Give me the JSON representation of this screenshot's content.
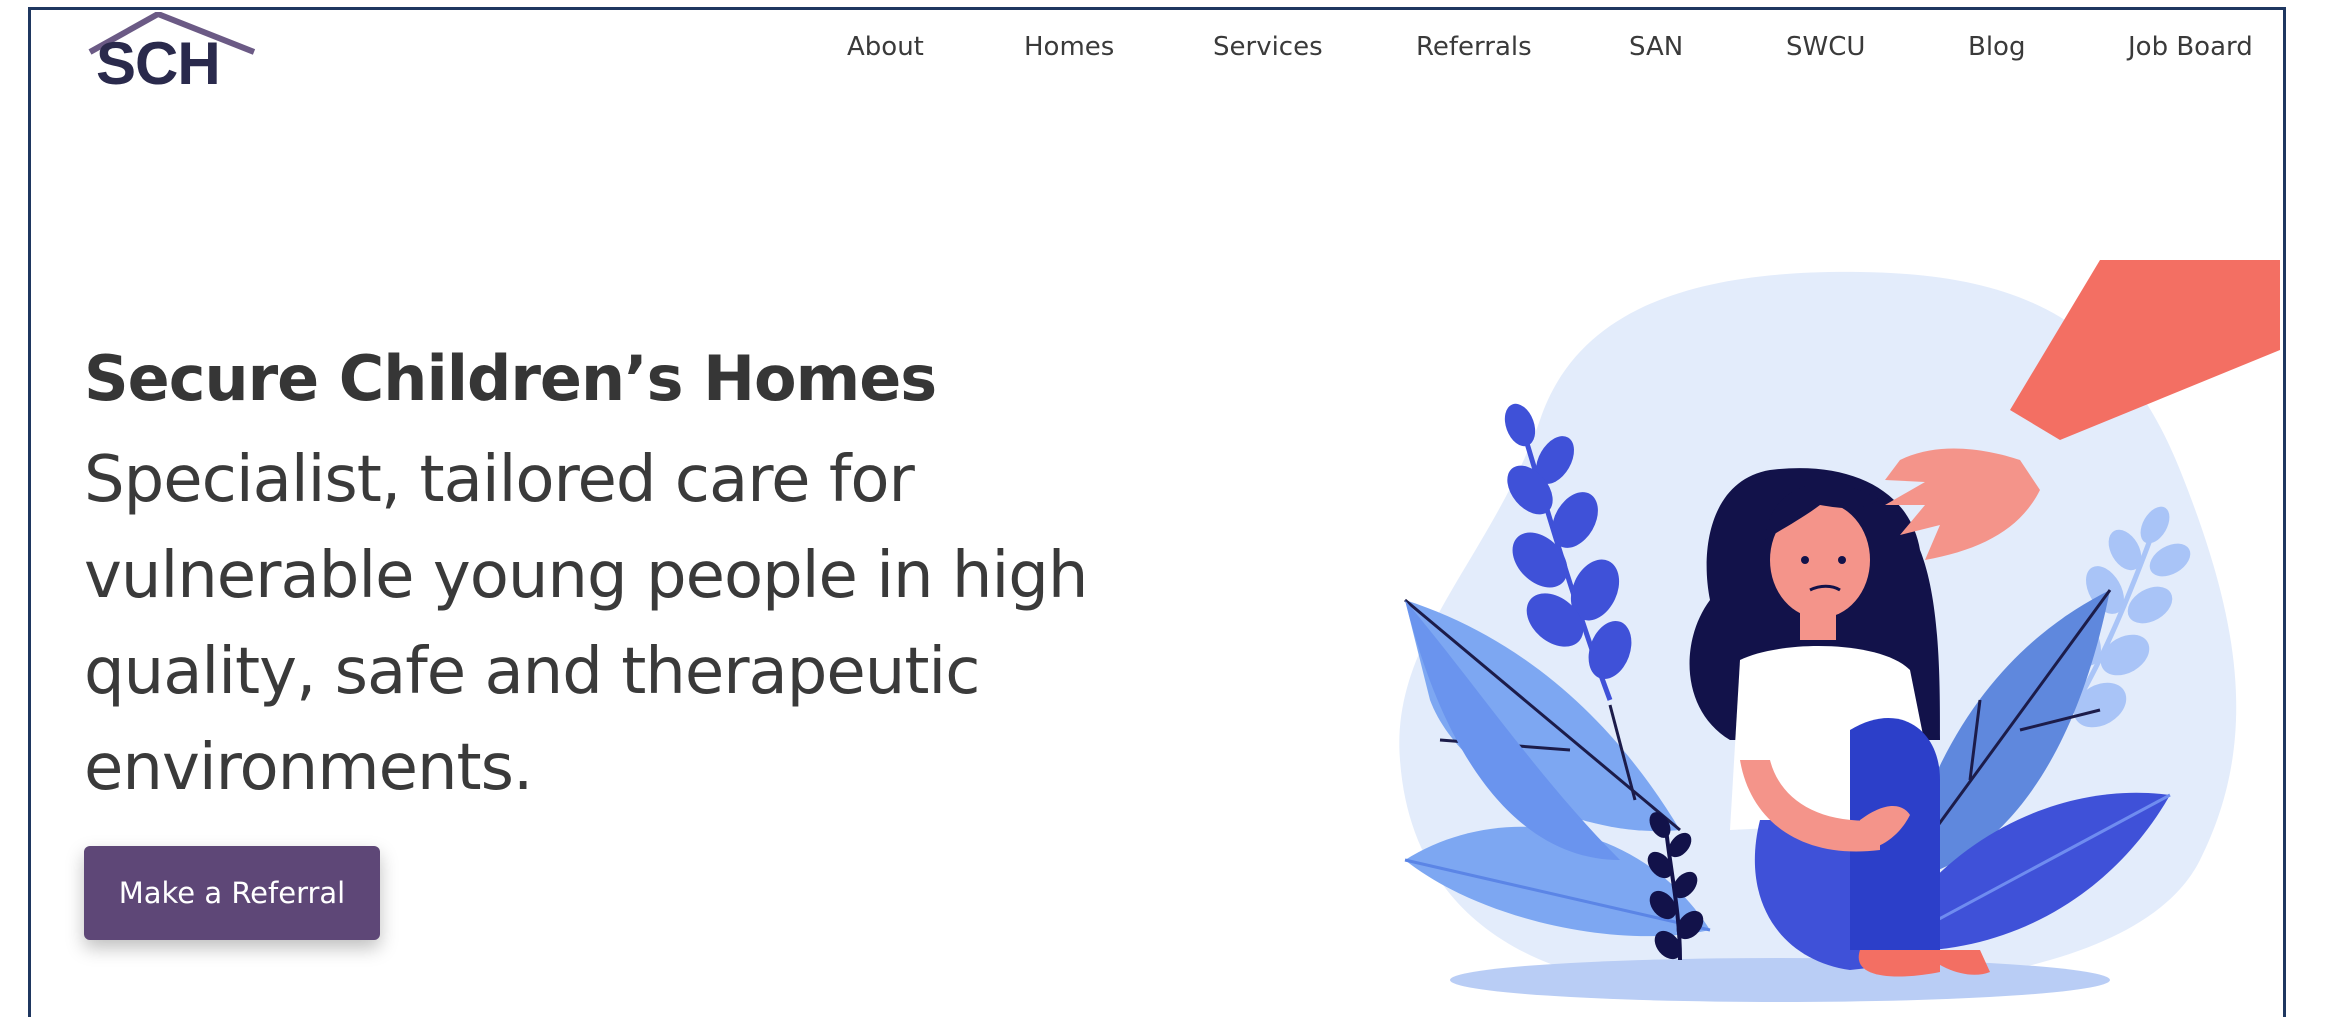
{
  "brand": {
    "logo_text": "SCH",
    "color": "#2a2a4c",
    "roof_color": "#6b5a85"
  },
  "nav": {
    "items": [
      "About",
      "Homes",
      "Services",
      "Referrals",
      "SAN",
      "SWCU",
      "Blog",
      "Job Board"
    ]
  },
  "hero": {
    "title": "Secure Children’s Homes",
    "subtitle_lines": [
      "Specialist, tailored care for",
      "vulnerable young people in high",
      "quality, safe and therapeutic",
      "environments."
    ],
    "cta_label": "Make a Referral",
    "cta_color": "#5e4777"
  },
  "illustration": {
    "subject": "girl-hugging-knees-with-helping-hand",
    "palette": {
      "blob": "#e3ecfb",
      "leaf_dark": "#3f51d8",
      "leaf_light": "#7da7f2",
      "hand": "#f4948a",
      "sleeve": "#f36f63",
      "hair": "#12124a"
    }
  }
}
